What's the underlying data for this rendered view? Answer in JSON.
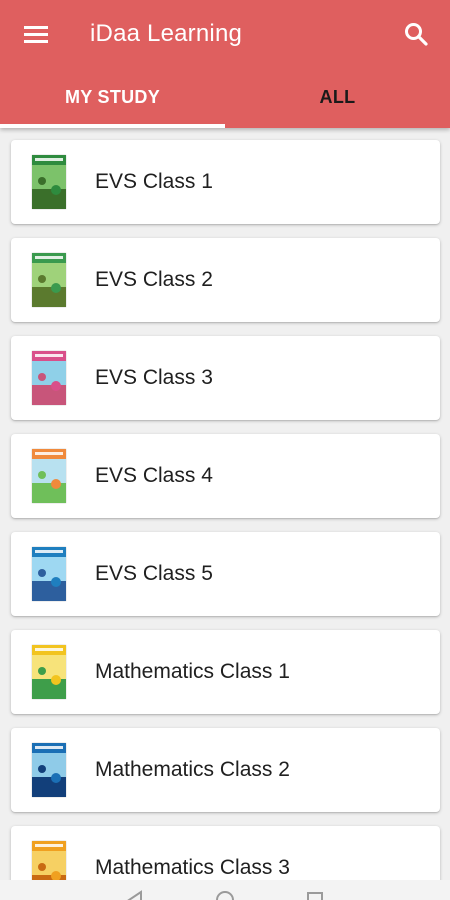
{
  "app": {
    "title": "iDaa Learning",
    "accent_color": "#df5f5f",
    "text_on_accent": "#ffffff"
  },
  "toolbar": {
    "menu_icon": "hamburger-menu-icon",
    "search_icon": "search-icon"
  },
  "tabs": [
    {
      "label": "MY STUDY",
      "active": true
    },
    {
      "label": "ALL",
      "active": false
    }
  ],
  "courses": [
    {
      "label": "EVS Class 1",
      "cover_icon": "book-cover-icon",
      "colors": [
        "#2e8b3e",
        "#7cc26a",
        "#3a6f2a"
      ]
    },
    {
      "label": "EVS Class 2",
      "cover_icon": "book-cover-icon",
      "colors": [
        "#3a9a4e",
        "#9fd27a",
        "#5b7a2e"
      ]
    },
    {
      "label": "EVS Class 3",
      "cover_icon": "book-cover-icon",
      "colors": [
        "#d94f8a",
        "#8fd0e8",
        "#c8557a"
      ]
    },
    {
      "label": "EVS Class 4",
      "cover_icon": "book-cover-icon",
      "colors": [
        "#f08a3c",
        "#b8e1f0",
        "#6fbf5a"
      ]
    },
    {
      "label": "EVS Class 5",
      "cover_icon": "book-cover-icon",
      "colors": [
        "#1f7fbf",
        "#9ed8f2",
        "#2d5f9e"
      ]
    },
    {
      "label": "Mathematics Class 1",
      "cover_icon": "book-cover-icon",
      "colors": [
        "#f2c41f",
        "#f7e37a",
        "#3e9e4a"
      ]
    },
    {
      "label": "Mathematics Class 2",
      "cover_icon": "book-cover-icon",
      "colors": [
        "#1b6fb5",
        "#8fcbe8",
        "#123f7a"
      ]
    },
    {
      "label": "Mathematics Class 3",
      "cover_icon": "book-cover-icon",
      "colors": [
        "#f0a020",
        "#f6d063",
        "#c96a12"
      ]
    }
  ],
  "system_nav": {
    "back_icon": "back-icon",
    "home_icon": "home-icon",
    "recents_icon": "recents-icon"
  }
}
